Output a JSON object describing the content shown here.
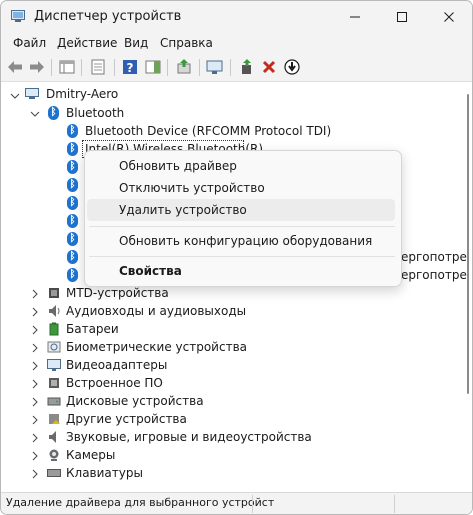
{
  "window": {
    "title": "Диспетчер устройств",
    "controls": {
      "minimize": "minimize",
      "maximize": "maximize",
      "close": "close"
    }
  },
  "menu": [
    "Файл",
    "Действие",
    "Вид",
    "Справка"
  ],
  "toolbar": {
    "buttons": [
      "back-arrow",
      "forward-arrow",
      "show-hide-console-tree",
      "properties",
      "help",
      "action-pane",
      "update-driver",
      "scan-hardware-changes",
      "add-legacy-hardware",
      "uninstall-device",
      "disable-device"
    ]
  },
  "tree": {
    "root": "Dmitry-Aero",
    "bluetooth": {
      "label": "Bluetooth",
      "children": [
        "Bluetooth Device (RFCOMM Protocol TDI)",
        "Intel(R) Wireless Bluetooth(R)"
      ],
      "hidden_suffix_1": "ергопотре",
      "hidden_suffix_2": "ергопотре"
    },
    "categories": [
      "MTD-устройства",
      "Аудиовходы и аудиовыходы",
      "Батареи",
      "Биометрические устройства",
      "Видеоадаптеры",
      "Встроенное ПО",
      "Дисковые устройства",
      "Другие устройства",
      "Звуковые, игровые и видеоустройства",
      "Камеры",
      "Клавиатуры"
    ]
  },
  "context_menu": {
    "update_driver": "Обновить драйвер",
    "disable_device": "Отключить устройство",
    "uninstall_device": "Удалить устройство",
    "scan_hardware": "Обновить конфигурацию оборудования",
    "properties": "Свойства"
  },
  "status": {
    "text": "Удаление драйвера для выбранного устройст"
  },
  "colors": {
    "accent": "#1e73d0",
    "toolbar_bg": "#f3f3f3",
    "menu_bg": "#f9f9f9",
    "hover": "#ececec"
  }
}
